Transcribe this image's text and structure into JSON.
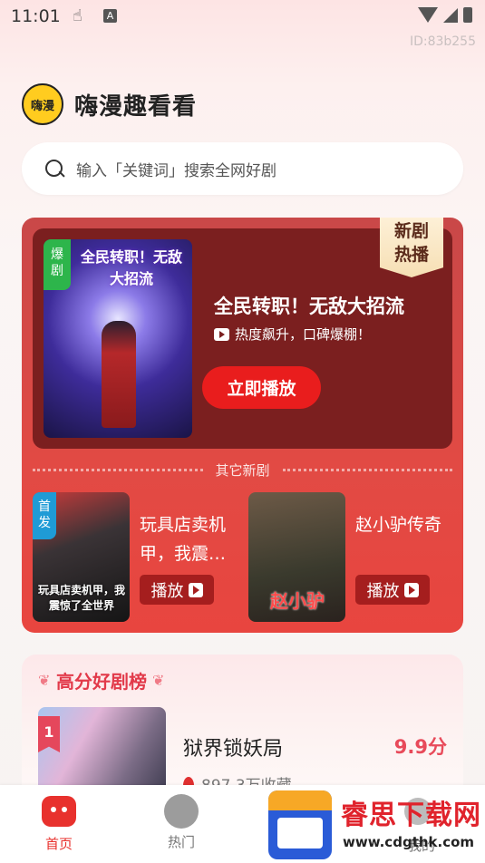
{
  "status_bar": {
    "time": "11:01",
    "a_badge": "A",
    "device_id": "ID:83b255"
  },
  "header": {
    "logo_text": "嗨漫",
    "app_title": "嗨漫趣看看"
  },
  "search": {
    "placeholder": "输入「关键词」搜索全网好剧"
  },
  "featured": {
    "corner_badge_line1": "新剧",
    "corner_badge_line2": "热播",
    "poster_tag_line1": "爆",
    "poster_tag_line2": "剧",
    "poster_caption": "全民转职！无敌大招流",
    "title": "全民转职！无敌大招流",
    "subtitle": "热度飙升，口碑爆棚！",
    "play_button": "立即播放"
  },
  "other_new": {
    "section_label": "其它新剧",
    "items": [
      {
        "tag_line1": "首",
        "tag_line2": "发",
        "poster_caption": "玩具店卖机甲，我震惊了全世界",
        "title": "玩具店卖机甲，我震…",
        "play_label": "播放"
      },
      {
        "poster_caption": "赵小驴",
        "title": "赵小驴传奇",
        "play_label": "播放"
      }
    ]
  },
  "ranking": {
    "section_title": "高分好剧榜",
    "items": [
      {
        "rank": "1",
        "title": "狱界锁妖局",
        "score": "9.9分",
        "favorites": "897.3万收藏"
      }
    ]
  },
  "tabbar": {
    "items": [
      {
        "label": "首页",
        "icon": "home-icon",
        "active": true
      },
      {
        "label": "热门",
        "icon": "flame-icon",
        "active": false
      },
      {
        "label": "我的",
        "icon": "profile-icon",
        "active": false
      }
    ]
  },
  "watermark": {
    "text": "睿思下载网",
    "url": "www.cdgthk.com"
  },
  "colors": {
    "accent": "#e8312d",
    "promo_bg": "#e24a44",
    "feature_bg": "#7b1f1f",
    "score": "#e84a5a"
  }
}
